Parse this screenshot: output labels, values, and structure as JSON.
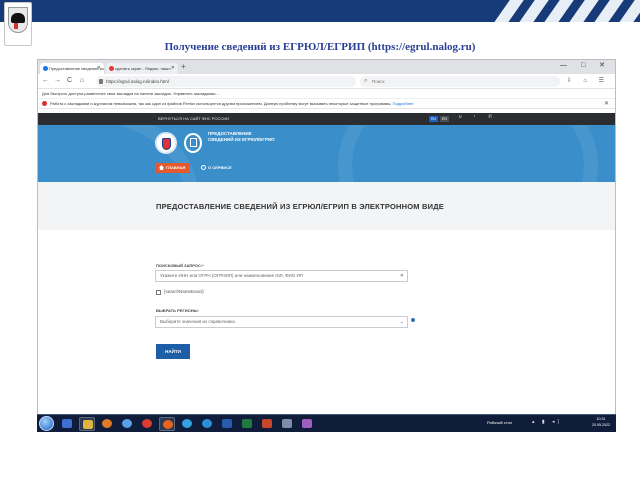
{
  "slide": {
    "title": "Получение сведений из ЕГРЮЛ/ЕГРИП (https://egrul.nalog.ru)"
  },
  "browser": {
    "tabs": [
      {
        "label": "Предоставление сведений из"
      },
      {
        "label": "сделать скрин - Яндекс: нашл"
      }
    ],
    "new_tab": "+",
    "window_controls": "— □ ✕",
    "back": "←",
    "forward": "→",
    "reload": "C",
    "home": "⌂",
    "url": "https://egrul.nalog.ru/index.html",
    "search_placeholder": "Поиск",
    "bookmarks_text": "Для быстрого доступа разместите свои закладки на панели закладок. Управлять закладками...",
    "infobar_text": "Работа с закладками и журналом невозможна, так как один из файлов Firefox используется другим приложением. Данную проблему могут вызывать некоторые защитные программы.",
    "infobar_link": "Подробнее",
    "infobar_close": "✕"
  },
  "site": {
    "top_link": "ВЕРНУТЬСЯ НА САЙТ ФНС РОССИИ",
    "lang_ru": "RU",
    "lang_en": "EN",
    "hero_title": "ПРЕДОСТАВЛЕНИЕ СВЕДЕНИЙ ИЗ ЕГРЮЛ/ЕГРИП",
    "home_button": "ГЛАВНАЯ",
    "about_button": "О СЕРВИСЕ",
    "page_title": "ПРЕДОСТАВЛЕНИЕ СВЕДЕНИЙ ИЗ ЕГРЮЛ/ЕГРИП В ЭЛЕКТРОННОМ ВИДЕ",
    "query_label": "ПОИСКОВЫЙ ЗАПРОС:*",
    "query_placeholder": "Укажите ИНН или ОГРН (ОГРНИП) или наименование ЮЛ, ФИО ИП",
    "clear": "✕",
    "exact_label": "{searchNameExact}",
    "region_label": "ВЫБРАТЬ РЕГИОНЫ:",
    "region_value": "Выберите значения из справочника",
    "chevron": "⌄",
    "find_button": "НАЙТИ"
  },
  "taskbar": {
    "desktop_label": "Рабочий стол",
    "clock_time": "10:31",
    "clock_date": "20.05.2022"
  },
  "colors": {
    "banner": "#173a78",
    "hero": "#3a8fca",
    "accent_orange": "#e4592d",
    "button_blue": "#1e5ea6"
  }
}
